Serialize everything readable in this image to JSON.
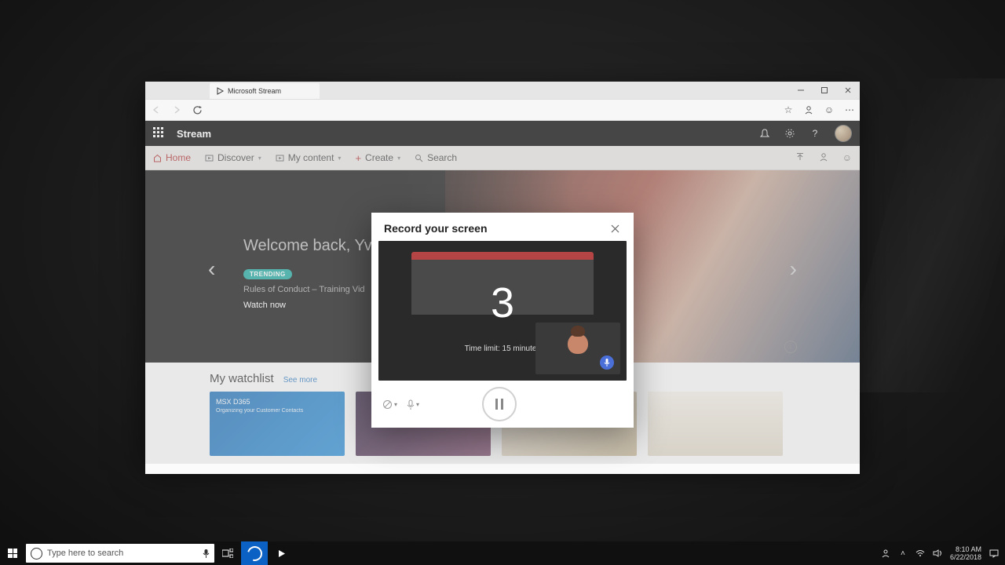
{
  "browser": {
    "tab_title": "Microsoft Stream"
  },
  "o365": {
    "brand": "Stream"
  },
  "nav": {
    "home": "Home",
    "discover": "Discover",
    "mycontent": "My content",
    "create": "Create",
    "search": "Search"
  },
  "hero": {
    "welcome": "Welcome back, Yvo",
    "trending": "TRENDING",
    "title": "Rules of Conduct – Training Vid",
    "watch": "Watch now"
  },
  "watchlist": {
    "heading": "My watchlist",
    "seemore": "See more",
    "thumb1_line1": "MSX D365",
    "thumb1_line2": "Organizing your Customer Contacts"
  },
  "modal": {
    "title": "Record your screen",
    "countdown": "3",
    "timelimit": "Time limit: 15 minutes"
  },
  "taskbar": {
    "search_placeholder": "Type here to search",
    "time": "8:10 AM",
    "date": "6/22/2018"
  }
}
